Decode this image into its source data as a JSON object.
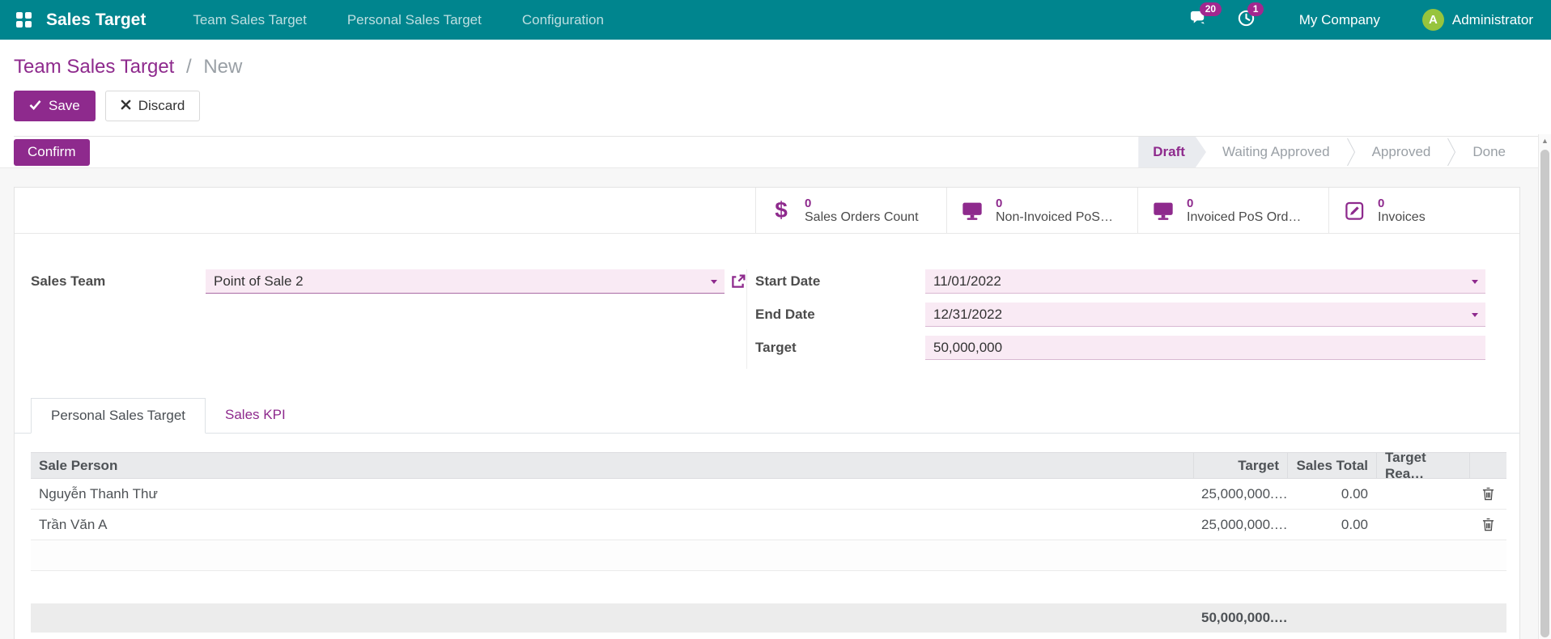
{
  "navbar": {
    "app_name": "Sales Target",
    "menu_items": [
      "Team Sales Target",
      "Personal Sales Target",
      "Configuration"
    ],
    "messages_badge": "20",
    "activities_badge": "1",
    "company": "My Company",
    "user_name": "Administrator",
    "avatar_letter": "A"
  },
  "breadcrumb": {
    "parent": "Team Sales Target",
    "separator": "/",
    "current": "New"
  },
  "buttons": {
    "save": "Save",
    "discard": "Discard",
    "confirm": "Confirm"
  },
  "statusbar": {
    "stages": [
      "Draft",
      "Waiting Approved",
      "Approved",
      "Done"
    ],
    "active_stage": "Draft"
  },
  "stat_buttons": [
    {
      "icon": "dollar-icon",
      "value": "0",
      "label": "Sales Orders Count"
    },
    {
      "icon": "monitor-icon",
      "value": "0",
      "label": "Non-Invoiced PoS…"
    },
    {
      "icon": "monitor-icon",
      "value": "0",
      "label": "Invoiced PoS Ord…"
    },
    {
      "icon": "edit-icon",
      "value": "0",
      "label": "Invoices"
    }
  ],
  "form": {
    "sales_team": {
      "label": "Sales Team",
      "value": "Point of Sale 2"
    },
    "start_date": {
      "label": "Start Date",
      "value": "11/01/2022"
    },
    "end_date": {
      "label": "End Date",
      "value": "12/31/2022"
    },
    "target": {
      "label": "Target",
      "value": "50,000,000"
    }
  },
  "tabs": {
    "personal": "Personal Sales Target",
    "kpi": "Sales KPI"
  },
  "table": {
    "headers": {
      "person": "Sale Person",
      "target": "Target",
      "sales_total": "Sales Total",
      "target_reached": "Target Rea…"
    },
    "rows": [
      {
        "person": "Nguyễn Thanh Thư",
        "target": "25,000,000.…",
        "sales_total": "0.00"
      },
      {
        "person": "Trần Văn A",
        "target": "25,000,000.…",
        "sales_total": "0.00"
      }
    ],
    "total_target": "50,000,000.…"
  },
  "icons": {
    "dollar": "$"
  },
  "colors": {
    "primary": "#8E2A8D",
    "navbar_bg": "#00858E",
    "badge_bg": "#A3278F",
    "input_bg": "#F9EAF4",
    "avatar_bg": "#97C43D"
  }
}
